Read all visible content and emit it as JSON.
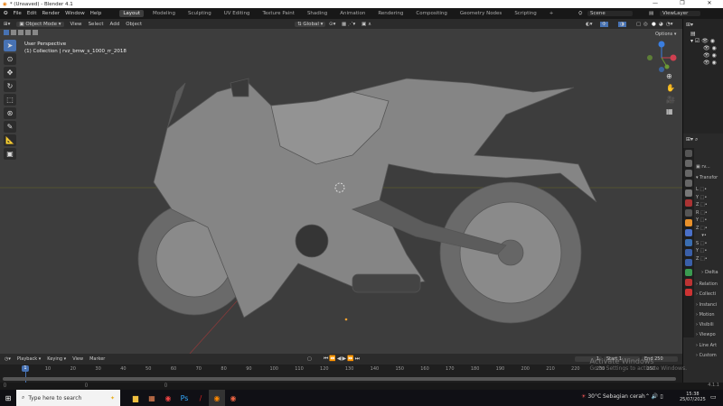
{
  "title": "* (Unsaved) - Blender 4.1",
  "window_controls": [
    "—",
    "❐",
    "✕"
  ],
  "menu": [
    "File",
    "Edit",
    "Render",
    "Window",
    "Help"
  ],
  "workspaces": [
    "Layout",
    "Modeling",
    "Sculpting",
    "UV Editing",
    "Texture Paint",
    "Shading",
    "Animation",
    "Rendering",
    "Compositing",
    "Geometry Nodes",
    "Scripting",
    "+"
  ],
  "scene": "Scene",
  "view_layer": "ViewLayer",
  "viewport_header": {
    "mode": "Object Mode",
    "menus": [
      "View",
      "Select",
      "Add",
      "Object"
    ],
    "orientation": "Global",
    "options": "Options"
  },
  "overlay_text": {
    "perspective": "User Perspective",
    "collection": "(1) Collection | rvz_bmw_s_1000_rr_2018"
  },
  "gizmo": {
    "x": "X",
    "y": "Y",
    "z": "Z"
  },
  "properties": {
    "object_name": "rv...",
    "panel": "Transfor",
    "axes": [
      "L",
      "Y",
      "Z",
      "R",
      "Y",
      "Z",
      "",
      "S",
      "Y",
      "Z"
    ],
    "sections": [
      "Delta",
      "Relation",
      "Collecti",
      "Instanci",
      "Motion",
      "Visibili",
      "Viewpo",
      "Line Art",
      "Custom"
    ]
  },
  "timeline": {
    "menus": [
      "Playback",
      "Keying",
      "View",
      "Marker"
    ],
    "current": "1",
    "start": "1",
    "end": "250",
    "start_label": "Start",
    "end_label": "End",
    "ticks": [
      10,
      20,
      30,
      40,
      50,
      60,
      70,
      80,
      90,
      100,
      110,
      120,
      130,
      140,
      150,
      160,
      170,
      180,
      190,
      200,
      210,
      220,
      230,
      250
    ]
  },
  "version": "4.1.1",
  "watermark": {
    "title": "Activate Windows",
    "sub": "Go to Settings to activate Windows."
  },
  "taskbar": {
    "search_placeholder": "Type here to search",
    "weather": "30°C  Sebagian cerah",
    "time": "15:38",
    "date": "25/07/2025"
  },
  "colors": {
    "accent": "#4772b3",
    "viewport": "#3d3d3d"
  }
}
